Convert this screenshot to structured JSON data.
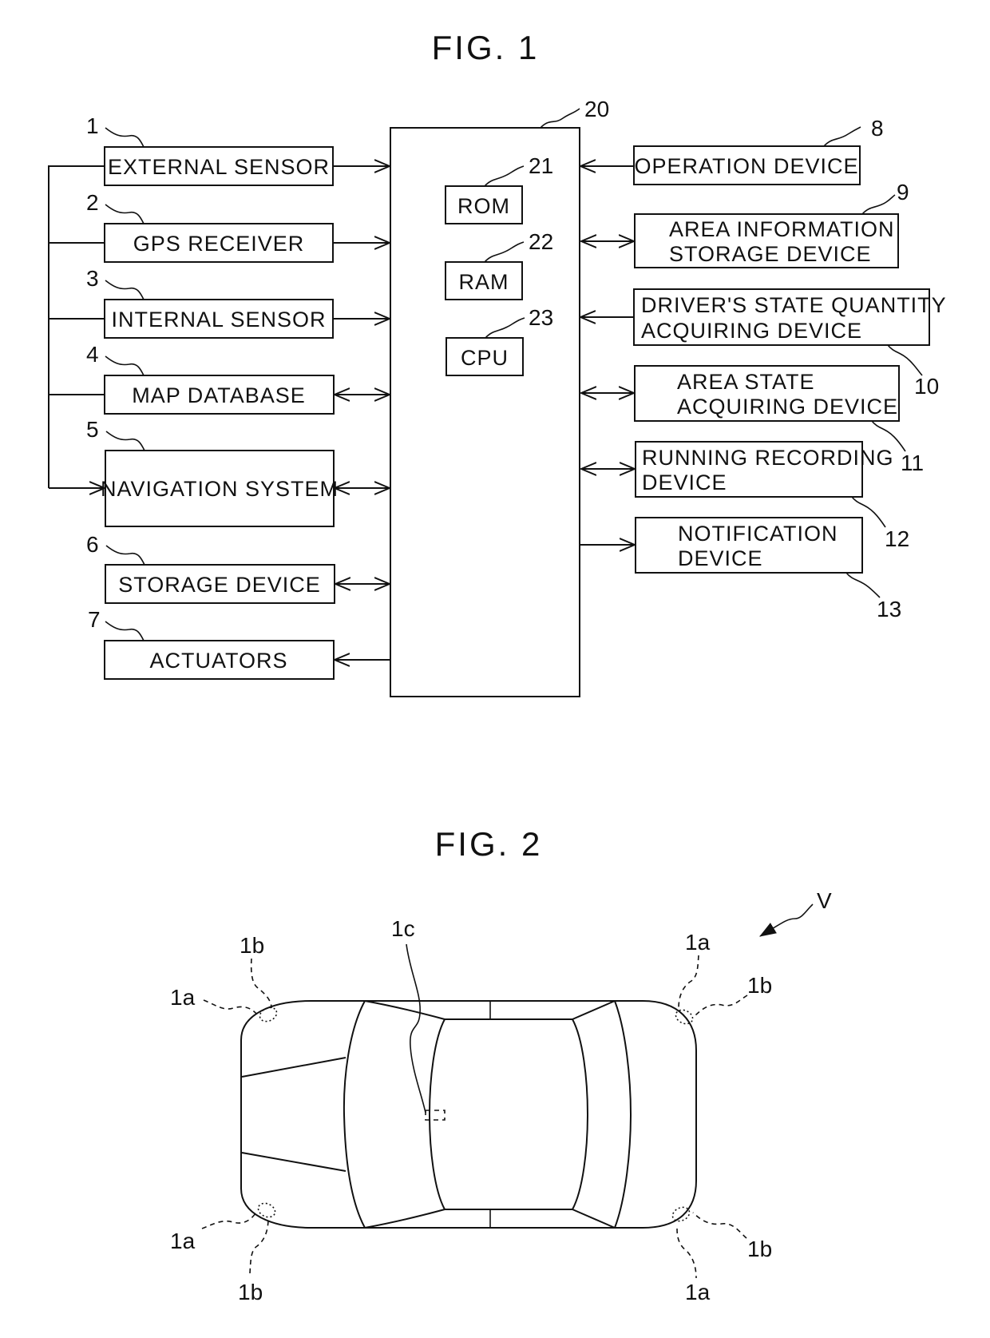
{
  "fig1": {
    "title": "FIG. 1",
    "controller": {
      "ref": "20"
    },
    "internal": [
      {
        "ref": "21",
        "label": "ROM"
      },
      {
        "ref": "22",
        "label": "RAM"
      },
      {
        "ref": "23",
        "label": "CPU"
      }
    ],
    "left_blocks": [
      {
        "ref": "1",
        "label": "EXTERNAL SENSOR",
        "connection": "to-controller"
      },
      {
        "ref": "2",
        "label": "GPS RECEIVER",
        "connection": "to-controller"
      },
      {
        "ref": "3",
        "label": "INTERNAL SENSOR",
        "connection": "to-controller"
      },
      {
        "ref": "4",
        "label": "MAP DATABASE",
        "connection": "bidirectional"
      },
      {
        "ref": "5",
        "label": "NAVIGATION SYSTEM",
        "connection": "bidirectional"
      },
      {
        "ref": "6",
        "label": "STORAGE DEVICE",
        "connection": "bidirectional"
      },
      {
        "ref": "7",
        "label": "ACTUATORS",
        "connection": "from-controller"
      }
    ],
    "right_blocks": [
      {
        "ref": "8",
        "lines": [
          "OPERATION DEVICE"
        ],
        "connection": "to-controller"
      },
      {
        "ref": "9",
        "lines": [
          "AREA INFORMATION",
          "STORAGE DEVICE"
        ],
        "connection": "bidirectional"
      },
      {
        "ref": "10",
        "lines": [
          "DRIVER'S STATE QUANTITY",
          "ACQUIRING DEVICE"
        ],
        "connection": "to-controller"
      },
      {
        "ref": "11",
        "lines": [
          "AREA STATE",
          "ACQUIRING DEVICE"
        ],
        "connection": "bidirectional"
      },
      {
        "ref": "12",
        "lines": [
          "RUNNING RECORDING",
          "DEVICE"
        ],
        "connection": "bidirectional"
      },
      {
        "ref": "13",
        "lines": [
          "NOTIFICATION",
          "DEVICE"
        ],
        "connection": "from-controller"
      }
    ]
  },
  "fig2": {
    "title": "FIG. 2",
    "vehicle_ref": "V",
    "sensor_labels": {
      "front_left_1a": "1a",
      "front_left_1b": "1b",
      "rear_left_1a": "1a",
      "rear_left_1b": "1b",
      "front_right_1a": "1a",
      "front_right_1b": "1b",
      "rear_right_1a": "1a",
      "rear_right_1b": "1b",
      "camera_1c": "1c"
    }
  }
}
